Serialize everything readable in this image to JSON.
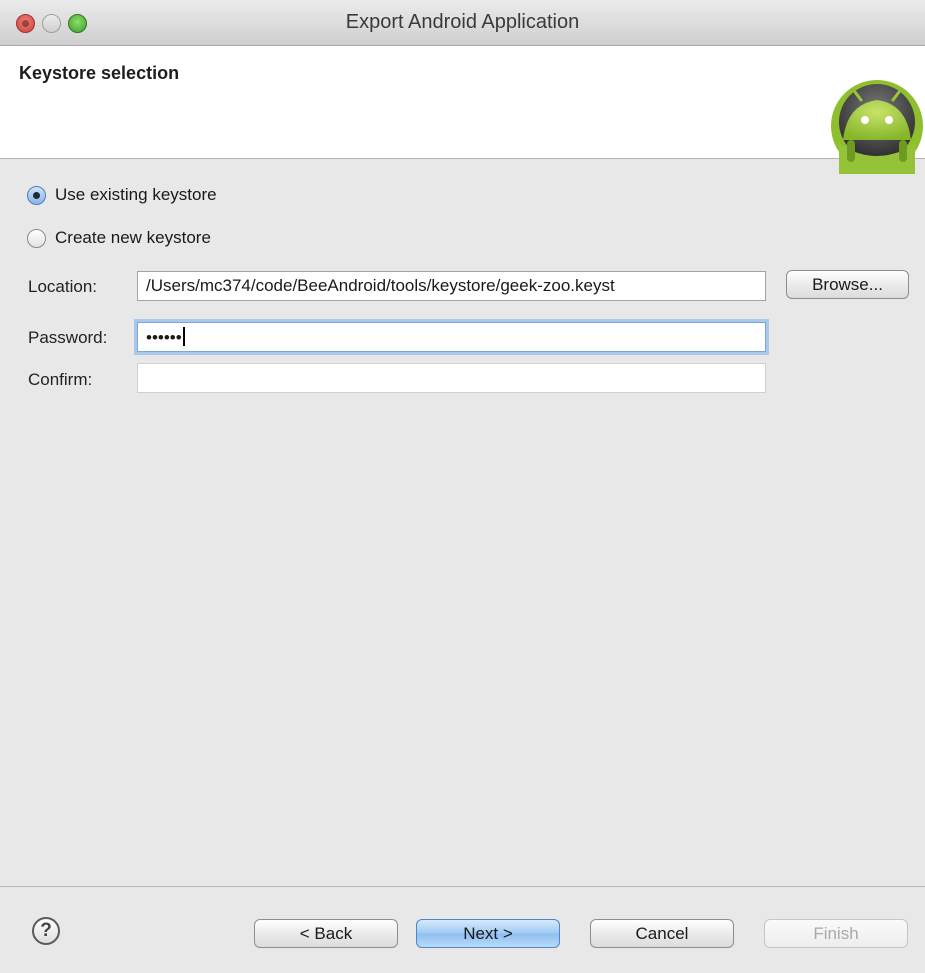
{
  "window": {
    "title": "Export Android Application"
  },
  "header": {
    "title": "Keystore selection",
    "logo_icon": "android-logo-icon"
  },
  "radios": [
    {
      "label": "Use existing keystore",
      "checked": true
    },
    {
      "label": "Create new keystore",
      "checked": false
    }
  ],
  "form": {
    "location_label": "Location:",
    "location_value": "/Users/mc374/code/BeeAndroid/tools/keystore/geek-zoo.keyst",
    "browse_label": "Browse...",
    "password_label": "Password:",
    "password_value": "••••••",
    "confirm_label": "Confirm:",
    "confirm_value": ""
  },
  "footer": {
    "help_icon": "help-icon",
    "back_label": "< Back",
    "next_label": "Next >",
    "cancel_label": "Cancel",
    "finish_label": "Finish"
  },
  "colors": {
    "accent": "#7aa6d8",
    "android_green": "#9ec43a"
  }
}
